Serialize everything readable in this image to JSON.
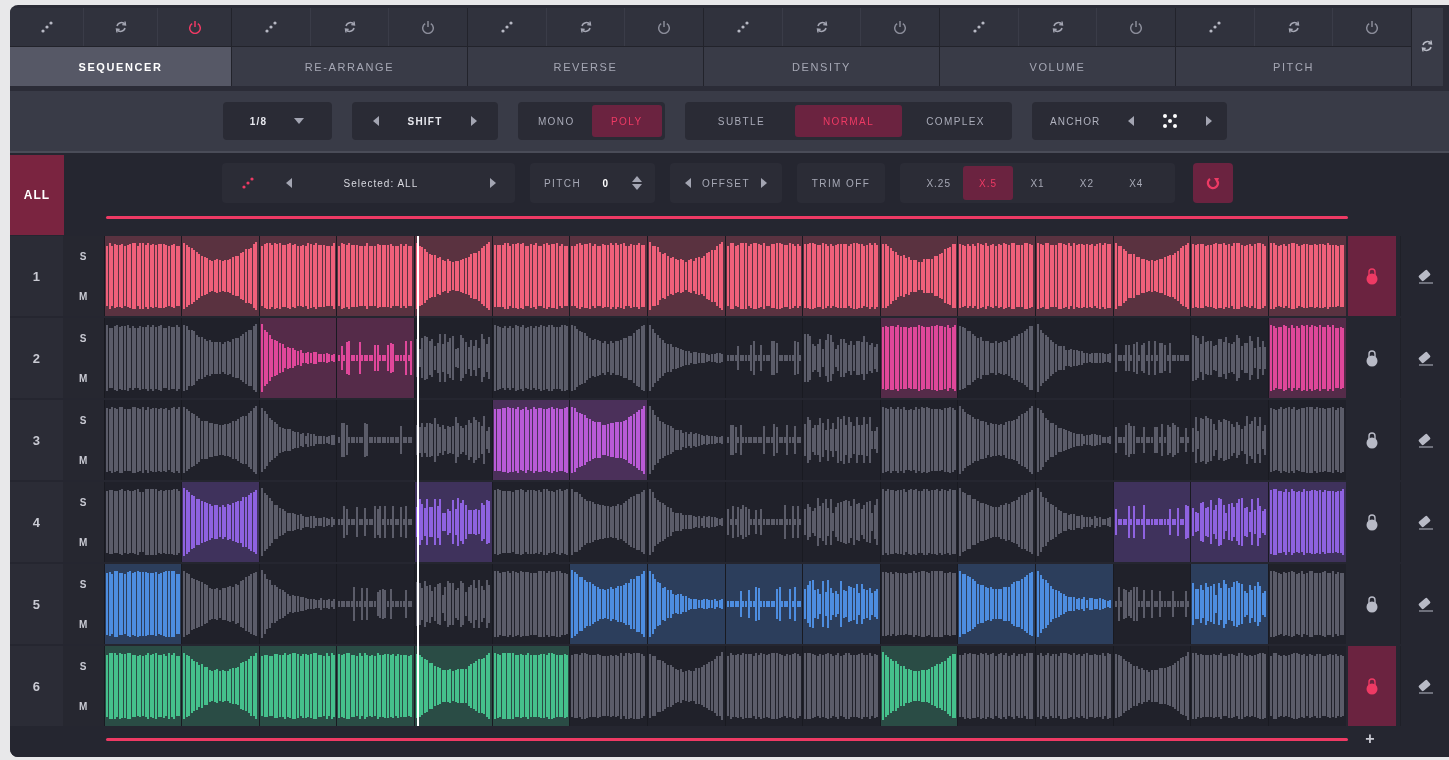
{
  "modules": [
    {
      "label": "SEQUENCER",
      "selected": true,
      "power_on": true
    },
    {
      "label": "RE-ARRANGE",
      "selected": false,
      "power_on": false
    },
    {
      "label": "REVERSE",
      "selected": false,
      "power_on": false
    },
    {
      "label": "DENSITY",
      "selected": false,
      "power_on": false
    },
    {
      "label": "VOLUME",
      "selected": false,
      "power_on": false
    },
    {
      "label": "PITCH",
      "selected": false,
      "power_on": false
    }
  ],
  "controls": {
    "division": "1/8",
    "shift_label": "SHIFT",
    "voice_modes": [
      {
        "label": "MONO",
        "selected": false
      },
      {
        "label": "POLY",
        "selected": true
      }
    ],
    "complexity": [
      {
        "label": "SUBTLE",
        "selected": false
      },
      {
        "label": "NORMAL",
        "selected": true
      },
      {
        "label": "COMPLEX",
        "selected": false
      }
    ],
    "anchor_label": "ANCHOR"
  },
  "sequencer": {
    "all_label": "ALL",
    "all_selected": true,
    "selection": "Selected: ALL",
    "pitch_label": "PITCH",
    "pitch_value": "0",
    "offset_label": "OFFSET",
    "trim_label": "TRIM OFF",
    "speeds": [
      {
        "label": "X.25",
        "selected": false
      },
      {
        "label": "X.5",
        "selected": true
      },
      {
        "label": "X1",
        "selected": false
      },
      {
        "label": "X2",
        "selected": false
      },
      {
        "label": "X4",
        "selected": false
      }
    ],
    "playhead": {
      "level": 0.25
    },
    "add_label": "+",
    "tracks": [
      {
        "number": "1",
        "solo_label": "S",
        "mute_label": "M",
        "color": "#f0607a",
        "locked": true,
        "cells": [
          {
            "selected": true
          },
          {
            "selected": true
          },
          {
            "selected": true
          },
          {
            "selected": true
          },
          {
            "selected": true
          },
          {
            "selected": true
          },
          {
            "selected": true
          },
          {
            "selected": true
          },
          {
            "selected": true
          },
          {
            "selected": true
          },
          {
            "selected": true
          },
          {
            "selected": true
          },
          {
            "selected": true
          },
          {
            "selected": true
          },
          {
            "selected": true
          },
          {
            "selected": true
          }
        ]
      },
      {
        "number": "2",
        "solo_label": "S",
        "mute_label": "M",
        "color": "#e0479a",
        "locked": false,
        "cells": [
          {
            "selected": false
          },
          {
            "selected": false
          },
          {
            "selected": true
          },
          {
            "selected": true
          },
          {
            "selected": false
          },
          {
            "selected": false
          },
          {
            "selected": false
          },
          {
            "selected": false
          },
          {
            "selected": false
          },
          {
            "selected": false
          },
          {
            "selected": true
          },
          {
            "selected": false
          },
          {
            "selected": false
          },
          {
            "selected": false
          },
          {
            "selected": false
          },
          {
            "selected": true
          }
        ]
      },
      {
        "number": "3",
        "solo_label": "S",
        "mute_label": "M",
        "color": "#b95ad6",
        "locked": false,
        "cells": [
          {
            "selected": false
          },
          {
            "selected": false
          },
          {
            "selected": false
          },
          {
            "selected": false
          },
          {
            "selected": false
          },
          {
            "selected": true
          },
          {
            "selected": true
          },
          {
            "selected": false
          },
          {
            "selected": false
          },
          {
            "selected": false
          },
          {
            "selected": false
          },
          {
            "selected": false
          },
          {
            "selected": false
          },
          {
            "selected": false
          },
          {
            "selected": false
          },
          {
            "selected": false
          }
        ]
      },
      {
        "number": "4",
        "solo_label": "S",
        "mute_label": "M",
        "color": "#8e62e0",
        "locked": false,
        "cells": [
          {
            "selected": false
          },
          {
            "selected": true
          },
          {
            "selected": false
          },
          {
            "selected": false
          },
          {
            "selected": true
          },
          {
            "selected": false
          },
          {
            "selected": false
          },
          {
            "selected": false
          },
          {
            "selected": false
          },
          {
            "selected": false
          },
          {
            "selected": false
          },
          {
            "selected": false
          },
          {
            "selected": false
          },
          {
            "selected": true
          },
          {
            "selected": true
          },
          {
            "selected": true
          }
        ]
      },
      {
        "number": "5",
        "solo_label": "S",
        "mute_label": "M",
        "color": "#4d8de0",
        "locked": false,
        "cells": [
          {
            "selected": true
          },
          {
            "selected": false
          },
          {
            "selected": false
          },
          {
            "selected": false
          },
          {
            "selected": false
          },
          {
            "selected": false
          },
          {
            "selected": true
          },
          {
            "selected": true
          },
          {
            "selected": true
          },
          {
            "selected": true
          },
          {
            "selected": false
          },
          {
            "selected": true
          },
          {
            "selected": true
          },
          {
            "selected": false
          },
          {
            "selected": true
          },
          {
            "selected": false
          }
        ]
      },
      {
        "number": "6",
        "solo_label": "S",
        "mute_label": "M",
        "color": "#45c08c",
        "locked": true,
        "cells": [
          {
            "selected": true
          },
          {
            "selected": true
          },
          {
            "selected": true
          },
          {
            "selected": true
          },
          {
            "selected": true
          },
          {
            "selected": true
          },
          {
            "selected": false
          },
          {
            "selected": false
          },
          {
            "selected": false
          },
          {
            "selected": false
          },
          {
            "selected": true
          },
          {
            "selected": false
          },
          {
            "selected": false
          },
          {
            "selected": false
          },
          {
            "selected": false
          },
          {
            "selected": false
          }
        ]
      }
    ]
  }
}
